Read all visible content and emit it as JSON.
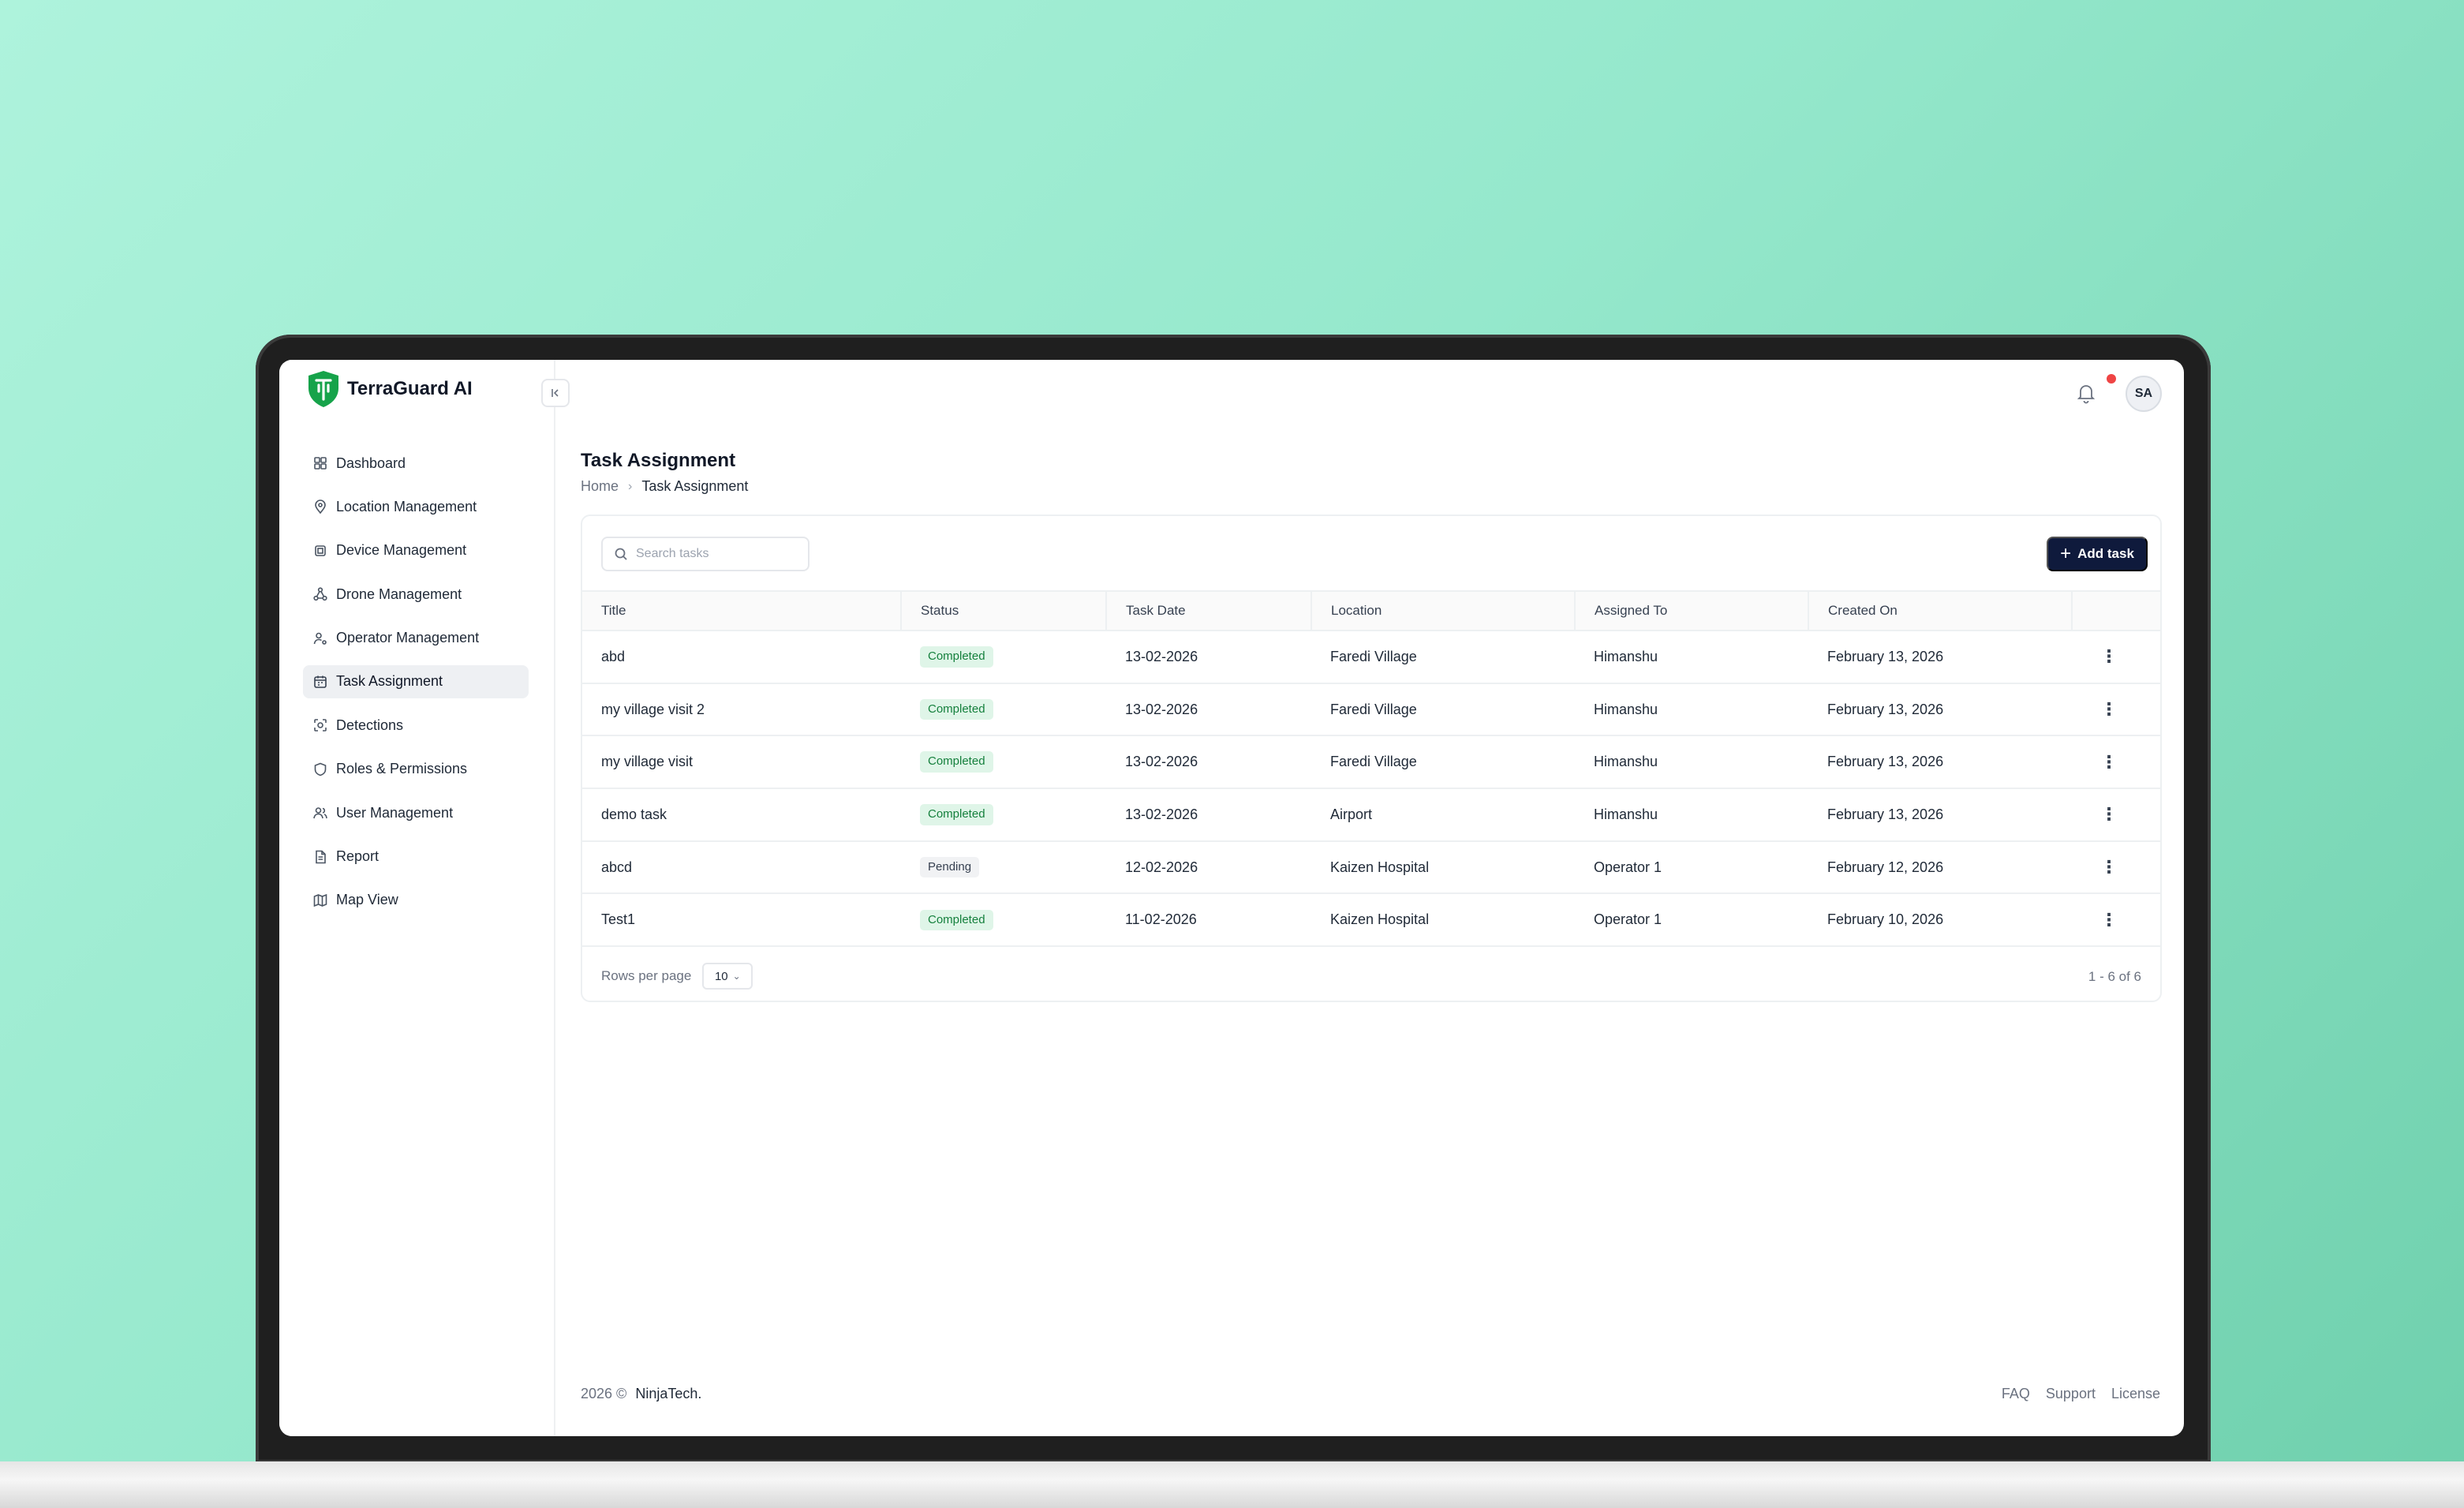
{
  "app": {
    "name": "TerraGuard AI"
  },
  "sidebar": {
    "items": [
      {
        "label": "Dashboard",
        "icon": "grid-icon"
      },
      {
        "label": "Location Management",
        "icon": "map-pin-icon"
      },
      {
        "label": "Device Management",
        "icon": "chip-icon"
      },
      {
        "label": "Drone Management",
        "icon": "network-icon"
      },
      {
        "label": "Operator Management",
        "icon": "user-cog-icon"
      },
      {
        "label": "Task Assignment",
        "icon": "calendar-icon",
        "active": true
      },
      {
        "label": "Detections",
        "icon": "scan-icon"
      },
      {
        "label": "Roles & Permissions",
        "icon": "shield-icon"
      },
      {
        "label": "User Management",
        "icon": "users-icon"
      },
      {
        "label": "Report",
        "icon": "file-icon"
      },
      {
        "label": "Map View",
        "icon": "map-icon"
      }
    ]
  },
  "header": {
    "avatar_initials": "SA",
    "notification_dot_color": "#ef4444"
  },
  "page": {
    "title": "Task Assignment",
    "breadcrumb": {
      "home": "Home",
      "current": "Task Assignment"
    }
  },
  "toolbar": {
    "search_placeholder": "Search tasks",
    "add_label": "Add task"
  },
  "table": {
    "columns": [
      "Title",
      "Status",
      "Task Date",
      "Location",
      "Assigned To",
      "Created On"
    ],
    "rows": [
      {
        "title": "abd",
        "status": "Completed",
        "task_date": "13-02-2026",
        "location": "Faredi Village",
        "assigned_to": "Himanshu",
        "created_on": "February 13, 2026"
      },
      {
        "title": "my village visit 2",
        "status": "Completed",
        "task_date": "13-02-2026",
        "location": "Faredi Village",
        "assigned_to": "Himanshu",
        "created_on": "February 13, 2026"
      },
      {
        "title": "my village visit",
        "status": "Completed",
        "task_date": "13-02-2026",
        "location": "Faredi Village",
        "assigned_to": "Himanshu",
        "created_on": "February 13, 2026"
      },
      {
        "title": "demo task",
        "status": "Completed",
        "task_date": "13-02-2026",
        "location": "Airport",
        "assigned_to": "Himanshu",
        "created_on": "February 13, 2026"
      },
      {
        "title": "abcd",
        "status": "Pending",
        "task_date": "12-02-2026",
        "location": "Kaizen Hospital",
        "assigned_to": "Operator 1",
        "created_on": "February 12, 2026"
      },
      {
        "title": "Test1",
        "status": "Completed",
        "task_date": "11-02-2026",
        "location": "Kaizen Hospital",
        "assigned_to": "Operator 1",
        "created_on": "February 10, 2026"
      }
    ],
    "actions_glyph": "⋮"
  },
  "pagination": {
    "rows_per_page_label": "Rows per page",
    "rows_per_page_value": "10",
    "range": "1 - 6 of 6"
  },
  "footer": {
    "copyright": "2026 ©",
    "company": "NinjaTech.",
    "links": [
      "FAQ",
      "Support",
      "License"
    ]
  },
  "colors": {
    "brand_green": "#16a34a",
    "primary_button": "#0f1a3c",
    "completed_bg": "#dff5e8",
    "completed_text": "#15803d"
  }
}
